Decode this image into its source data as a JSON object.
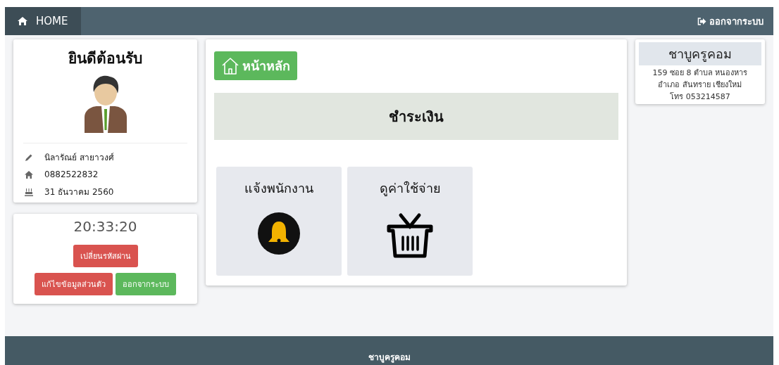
{
  "navbar": {
    "home": "HOME",
    "logout": "ออกจากระบบ"
  },
  "profile": {
    "title": "ยินดีต้อนรับ",
    "details": [
      {
        "kind": "name",
        "text": "นิลารัณย์ สายาวงศ์"
      },
      {
        "kind": "phone",
        "text": "0882522832"
      },
      {
        "kind": "date",
        "text": "31 ธันวาคม 2560"
      }
    ]
  },
  "clock": {
    "time": "20:33:20",
    "buttons": [
      {
        "label": "เปลี่ยนรหัสผ่าน",
        "kind": "danger"
      },
      {
        "label": "แก้ไขข้อมูลส่วนตัว",
        "kind": "danger"
      },
      {
        "label": "ออกจากระบบ",
        "kind": "success"
      }
    ]
  },
  "main": {
    "home_button": "หน้าหลัก",
    "heading": "ชำระเงิน",
    "tiles": [
      {
        "label": "แจ้งพนักงาน",
        "kind": "bell"
      },
      {
        "label": "ดูค่าใช้จ่าย",
        "kind": "basket"
      }
    ]
  },
  "shop": {
    "name": "ชาบูครูคอม",
    "address": [
      "159 ซอย 8 ตำบล หนองหาร",
      "อำเภอ สันทราย เชียงใหม่",
      "โทร 053214587"
    ]
  },
  "footer": {
    "name": "ชาบูครูคอม"
  }
}
